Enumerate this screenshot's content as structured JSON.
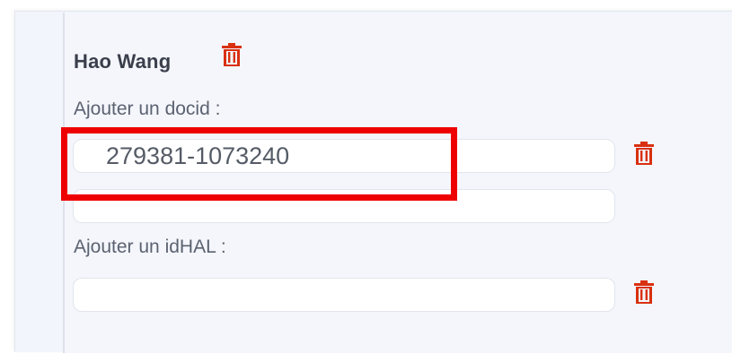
{
  "author": {
    "name": "Hao Wang",
    "delete_icon": "trash-icon"
  },
  "docid_section": {
    "label": "Ajouter un docid :",
    "inputs": [
      {
        "value": "279381-1073240",
        "delete_icon": "trash-icon"
      },
      {
        "value": ""
      }
    ]
  },
  "idhal_section": {
    "label": "Ajouter un idHAL :",
    "inputs": [
      {
        "value": "",
        "delete_icon": "trash-icon"
      }
    ]
  },
  "colors": {
    "delete_red": "#d9300f",
    "highlight_red": "#ee0000",
    "panel_background": "#f4f6fc"
  }
}
